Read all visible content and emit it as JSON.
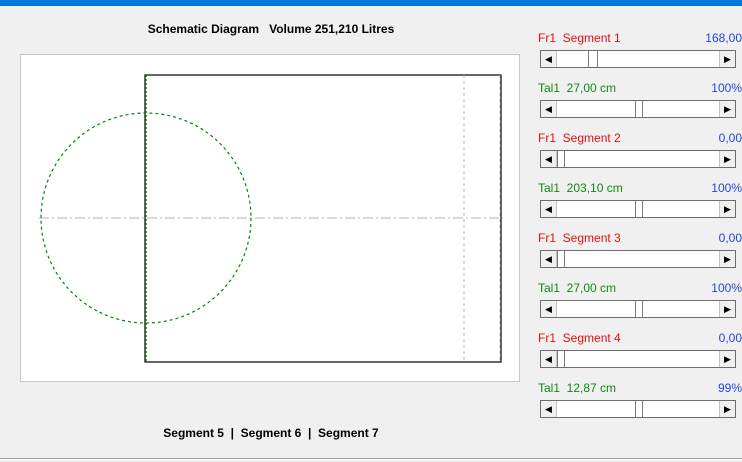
{
  "diagram": {
    "title": "Schematic Diagram   Volume 251,210 Litres",
    "segments_caption": "Segment 5  |  Segment 6  |  Segment 7"
  },
  "colors": {
    "fr_label": "#e01010",
    "tal_label": "#118811",
    "value_text": "#2346d8",
    "accent": "#0078d7",
    "circle": "#008800"
  },
  "controls": [
    {
      "id": "fr1",
      "label": "Fr1  Segment 1",
      "value": "168,00",
      "kind": "fr",
      "thumb_start": 0.19,
      "thumb_size": 0.06
    },
    {
      "id": "tal1",
      "label": "Tal1  27,00 cm",
      "value": "100%",
      "kind": "tal",
      "thumb_start": 0.48,
      "thumb_size": 0.05
    },
    {
      "id": "fr2",
      "label": "Fr1  Segment 2",
      "value": "0,00",
      "kind": "fr",
      "thumb_start": 0.0,
      "thumb_size": 0.05
    },
    {
      "id": "tal2",
      "label": "Tal1  203,10 cm",
      "value": "100%",
      "kind": "tal",
      "thumb_start": 0.48,
      "thumb_size": 0.05
    },
    {
      "id": "fr3",
      "label": "Fr1  Segment 3",
      "value": "0,00",
      "kind": "fr",
      "thumb_start": 0.0,
      "thumb_size": 0.05
    },
    {
      "id": "tal3",
      "label": "Tal1  27,00 cm",
      "value": "100%",
      "kind": "tal",
      "thumb_start": 0.48,
      "thumb_size": 0.05
    },
    {
      "id": "fr4",
      "label": "Fr1  Segment 4",
      "value": "0,00",
      "kind": "fr",
      "thumb_start": 0.0,
      "thumb_size": 0.05
    },
    {
      "id": "tal4",
      "label": "Tal1  12,87 cm",
      "value": "99%",
      "kind": "tal",
      "thumb_start": 0.48,
      "thumb_size": 0.05
    }
  ],
  "icons": {
    "scroll_left": "arrow-left-icon",
    "scroll_right": "arrow-right-icon"
  }
}
